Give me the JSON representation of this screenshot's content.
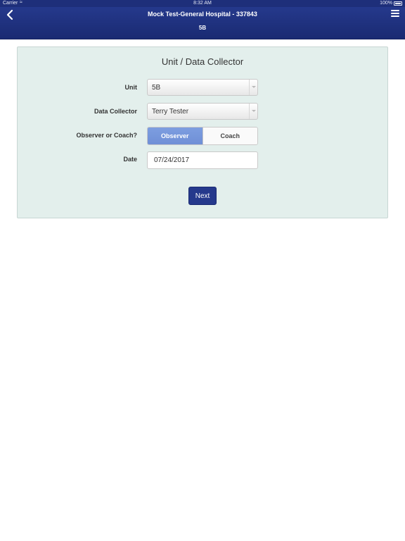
{
  "status_bar": {
    "carrier": "Carrier",
    "time": "8:32 AM",
    "battery": "100%"
  },
  "header": {
    "title": "Mock Test-General Hospital - 337843",
    "subtitle": "5B",
    "back_icon": "chevron-left-icon",
    "menu_icon": "hamburger-menu-icon"
  },
  "form": {
    "title": "Unit / Data Collector",
    "unit_label": "Unit",
    "unit_value": "5B",
    "collector_label": "Data Collector",
    "collector_value": "Terry Tester",
    "role_label": "Observer or Coach?",
    "role_options": [
      "Observer",
      "Coach"
    ],
    "role_selected": "Observer",
    "date_label": "Date",
    "date_value": "07/24/2017",
    "next_label": "Next"
  },
  "colors": {
    "nav_bar": "#25398c",
    "card_bg": "#e3efec",
    "segment_active": "#7d9ee0",
    "next_button": "#25398c"
  }
}
